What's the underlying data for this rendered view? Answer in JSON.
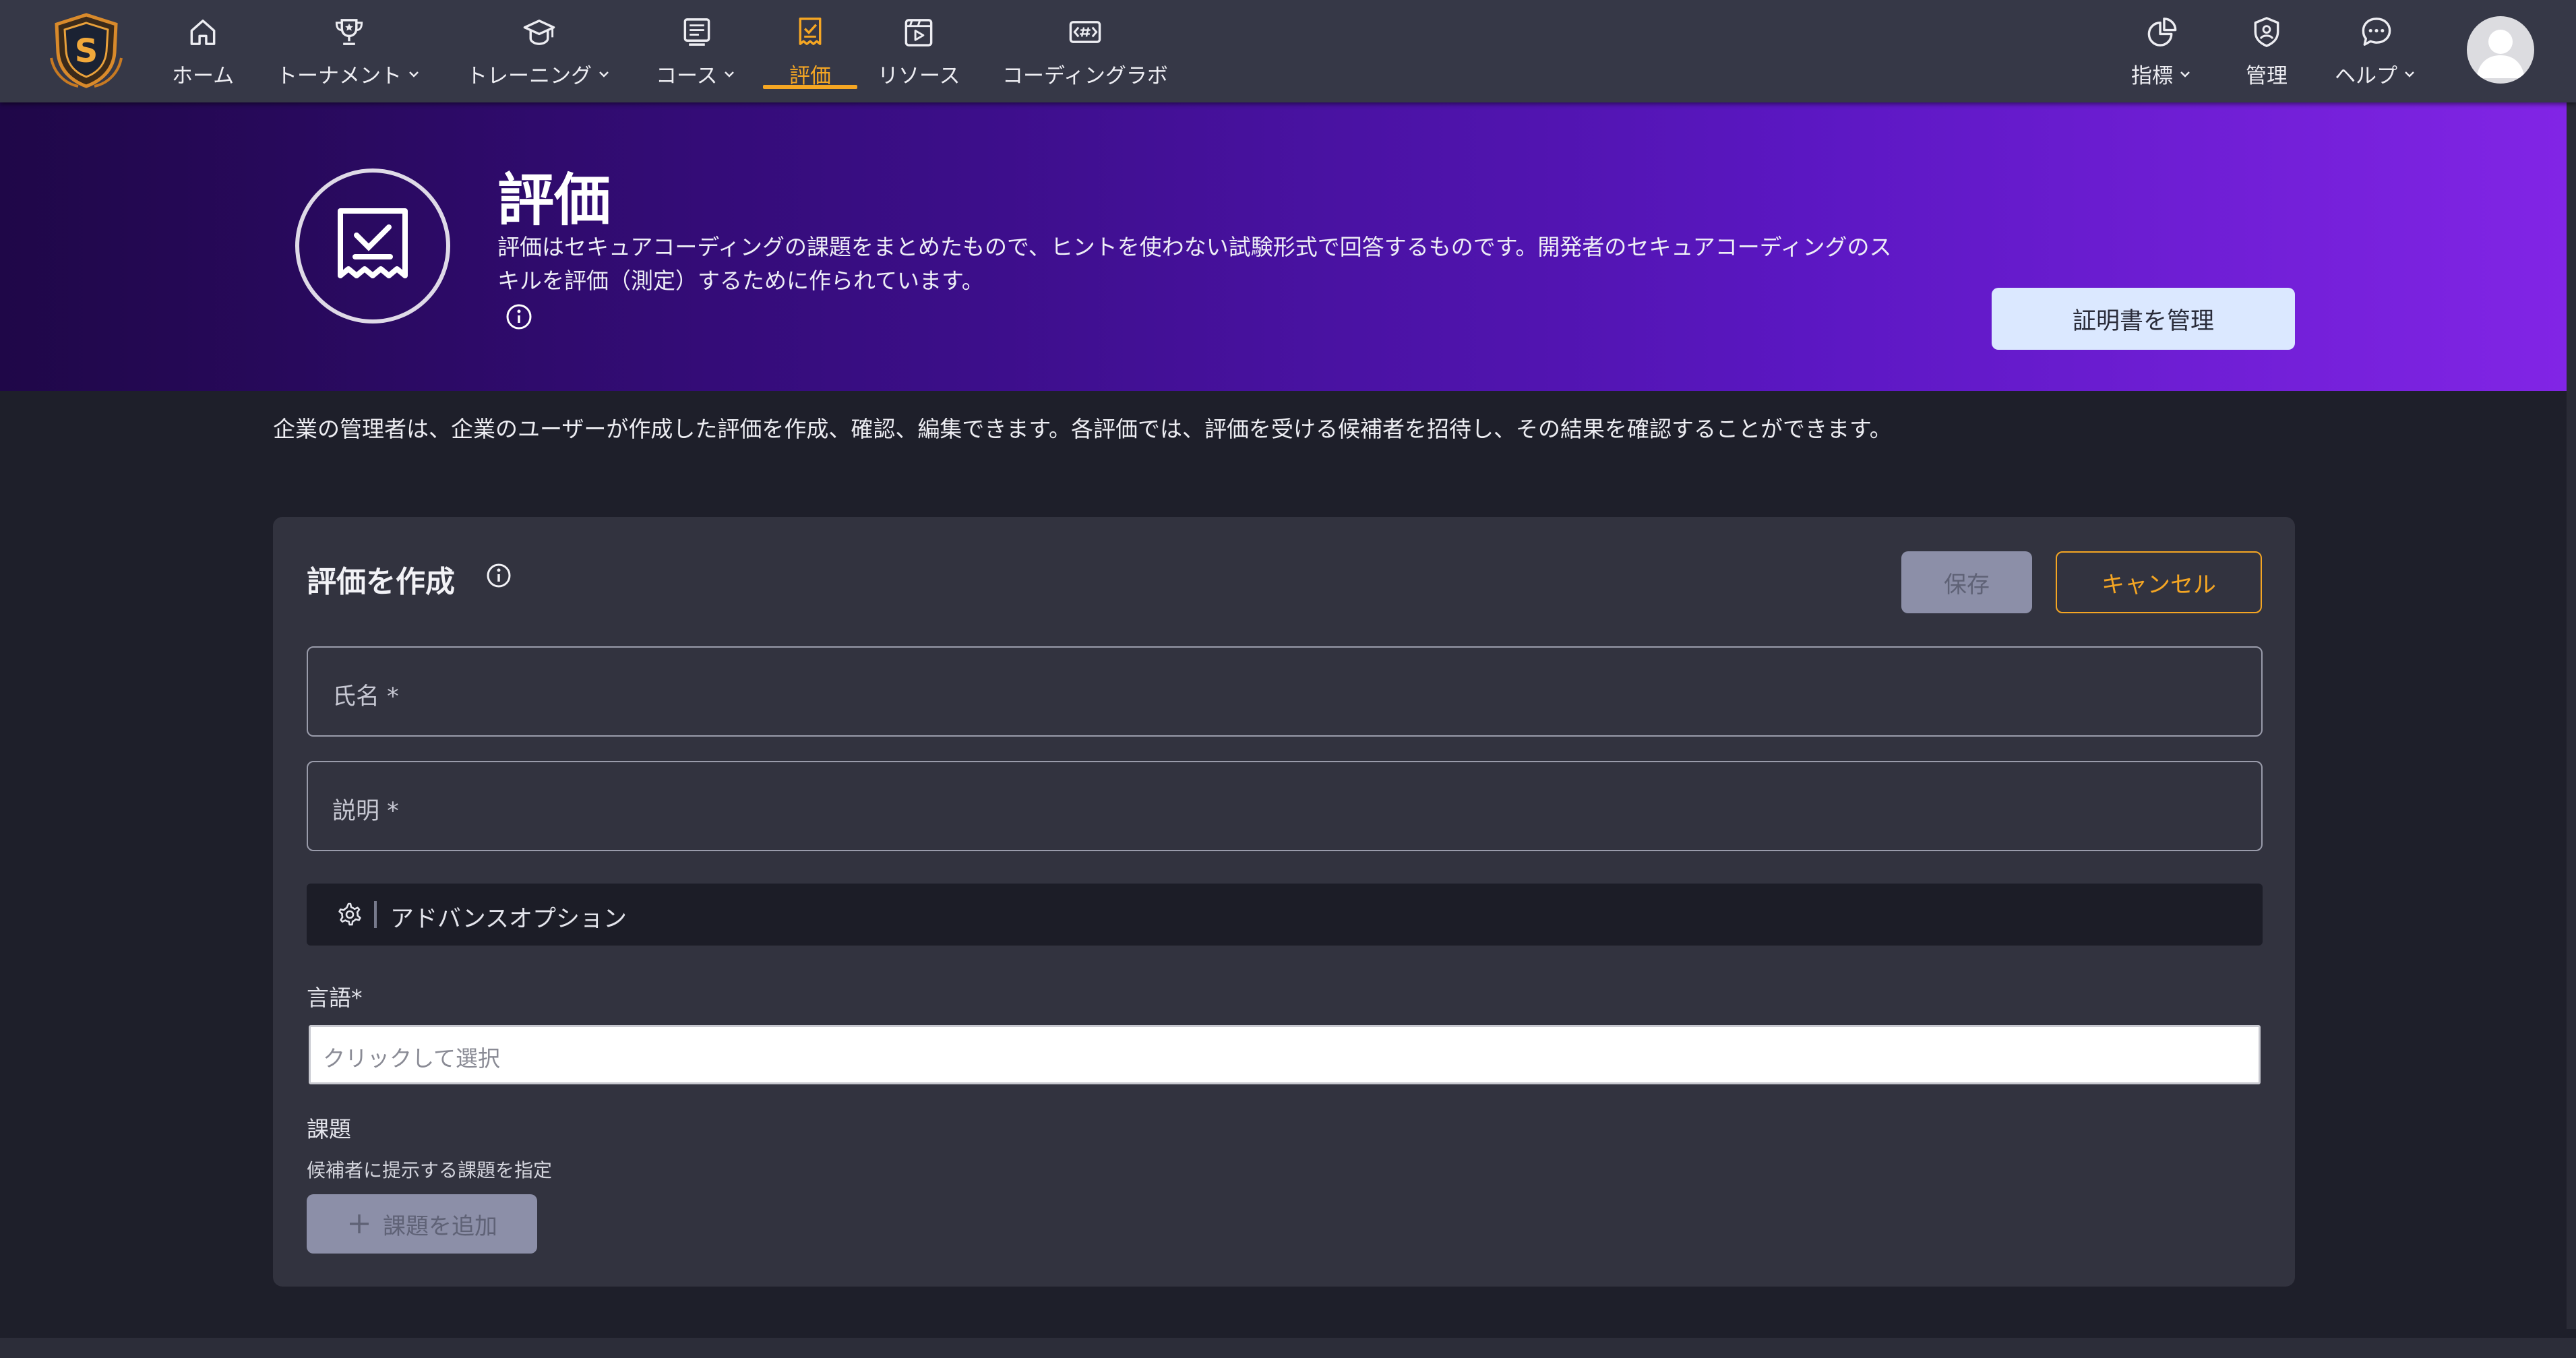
{
  "nav": {
    "items": [
      {
        "label": "ホーム",
        "icon": "home-icon",
        "has_dropdown": false,
        "active": false
      },
      {
        "label": "トーナメント",
        "icon": "trophy-icon",
        "has_dropdown": true,
        "active": false
      },
      {
        "label": "トレーニング",
        "icon": "graduation-cap-icon",
        "has_dropdown": true,
        "active": false
      },
      {
        "label": "コース",
        "icon": "course-list-icon",
        "has_dropdown": true,
        "active": false
      },
      {
        "label": "評価",
        "icon": "assessment-icon",
        "has_dropdown": false,
        "active": true
      },
      {
        "label": "リソース",
        "icon": "resource-video-icon",
        "has_dropdown": false,
        "active": false
      },
      {
        "label": "コーディングラボ",
        "icon": "code-lab-icon",
        "has_dropdown": false,
        "active": false
      }
    ],
    "right_items": [
      {
        "label": "指標",
        "icon": "metrics-pie-icon",
        "has_dropdown": true
      },
      {
        "label": "管理",
        "icon": "admin-shield-icon",
        "has_dropdown": false
      },
      {
        "label": "ヘルプ",
        "icon": "help-chat-icon",
        "has_dropdown": true
      }
    ],
    "accent_color": "#f5a623"
  },
  "hero": {
    "title": "評価",
    "description": "評価はセキュアコーディングの課題をまとめたもので、ヒントを使わない試験形式で回答するものです。開発者のセキュアコーディングのスキルを評価（測定）するために作られています。",
    "manage_cert_button": "証明書を管理"
  },
  "intro_text": "企業の管理者は、企業のユーザーが作成した評価を作成、確認、編集できます。各評価では、評価を受ける候補者を招待し、その結果を確認することができます。",
  "form": {
    "title": "評価を作成",
    "save_button": "保存",
    "cancel_button": "キャンセル",
    "name_placeholder": "氏名 *",
    "description_placeholder": "説明 *",
    "advanced_options_label": "アドバンスオプション",
    "language_label": "言語*",
    "language_placeholder": "クリックして選択",
    "topics_label": "課題",
    "topics_hint": "候補者に提示する課題を指定",
    "add_topic_button": "課題を追加"
  }
}
